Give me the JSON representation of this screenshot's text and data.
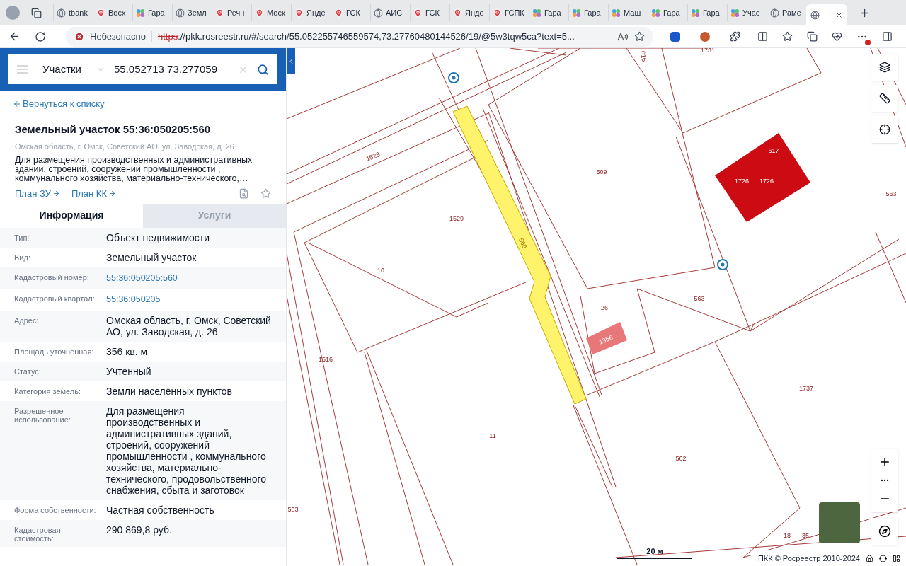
{
  "browser": {
    "tabs": [
      {
        "label": "tbank",
        "kind": "page",
        "selected": false
      },
      {
        "label": "Восх",
        "kind": "pin",
        "selected": false
      },
      {
        "label": "Гара",
        "kind": "dots",
        "selected": false
      },
      {
        "label": "Земл",
        "kind": "page",
        "selected": false
      },
      {
        "label": "Речн",
        "kind": "pin",
        "selected": false
      },
      {
        "label": "Моск",
        "kind": "pin",
        "selected": false
      },
      {
        "label": "Янде",
        "kind": "pin",
        "selected": false
      },
      {
        "label": "ГСК",
        "kind": "pin",
        "selected": false
      },
      {
        "label": "АИС",
        "kind": "page",
        "selected": false
      },
      {
        "label": "ГСК",
        "kind": "pin",
        "selected": false
      },
      {
        "label": "Янде",
        "kind": "pin",
        "selected": false
      },
      {
        "label": "ГСПК",
        "kind": "pin",
        "selected": false
      },
      {
        "label": "Гара",
        "kind": "dots",
        "selected": false
      },
      {
        "label": "Гара",
        "kind": "dots",
        "selected": false
      },
      {
        "label": "Маш",
        "kind": "dots",
        "selected": false
      },
      {
        "label": "Гара",
        "kind": "dots",
        "selected": false
      },
      {
        "label": "Гара",
        "kind": "dots",
        "selected": false
      },
      {
        "label": "Учас",
        "kind": "dots",
        "selected": false
      },
      {
        "label": "Раме",
        "kind": "page",
        "selected": false
      },
      {
        "kind": "page",
        "selected": true
      }
    ],
    "security": "Небезопасно",
    "url_scheme": "https",
    "url_rest": "://pkk.rosreestr.ru/#/search/55.052255746559574,73.27760480144526/19/@5w3tqw5ca?text=5..."
  },
  "panel": {
    "search": {
      "category": "Участки",
      "value": "55.052713 73.277059"
    },
    "back_link": "Вернуться к списку",
    "title": "Земельный участок 55:36:050205:560",
    "address": "Омская область, г. Омск, Советский АО, ул. Заводская, д. 26",
    "description": "Для размещения производственных и административных зданий, строений, сооружений промышленности , коммунального хозяйства, материально-технического,…",
    "links": [
      "План ЗУ",
      "План КК"
    ],
    "tabs": [
      {
        "label": "Информация",
        "selected": true
      },
      {
        "label": "Услуги",
        "selected": false
      }
    ],
    "rows": [
      {
        "label": "Тип:",
        "value": "Объект недвижимости",
        "kind": "text"
      },
      {
        "label": "Вид:",
        "value": "Земельный участок",
        "kind": "text"
      },
      {
        "label": "Кадастровый номер:",
        "value": "55:36:050205:560",
        "kind": "link"
      },
      {
        "label": "Кадастровый квартал:",
        "value": "55:36:050205",
        "kind": "link"
      },
      {
        "label": "Адрес:",
        "value": "Омская область, г. Омск, Советский АО, ул. Заводская, д. 26",
        "kind": "text"
      },
      {
        "label": "Площадь уточненная:",
        "value": "356 кв. м",
        "kind": "text"
      },
      {
        "label": "Статус:",
        "value": "Учтенный",
        "kind": "text"
      },
      {
        "label": "Категория земель:",
        "value": "Земли населённых пунктов",
        "kind": "text"
      },
      {
        "label": "Разрешенное использование:",
        "value": "Для размещения производственных и административных зданий, строений, сооружений промышленности , коммунального хозяйства, материально-технического, продовольственного снабжения, сбыта и заготовок",
        "kind": "text"
      },
      {
        "label": "Форма собственности:",
        "value": "Частная собственность",
        "kind": "text"
      },
      {
        "label": "Кадастровая стоимость:",
        "value": "290 869,8 руб.",
        "kind": "text"
      }
    ]
  },
  "map": {
    "labels": [
      "1731",
      "616",
      "1528",
      "509",
      "617",
      "1726",
      "1726",
      "563",
      "1529",
      "10",
      "560",
      "563",
      "26",
      "1356",
      "1516",
      "11",
      "1737",
      "562",
      "503",
      "18",
      "35"
    ],
    "scale": "20 м",
    "attribution": "ПКК © Росреестр 2010-2024"
  }
}
